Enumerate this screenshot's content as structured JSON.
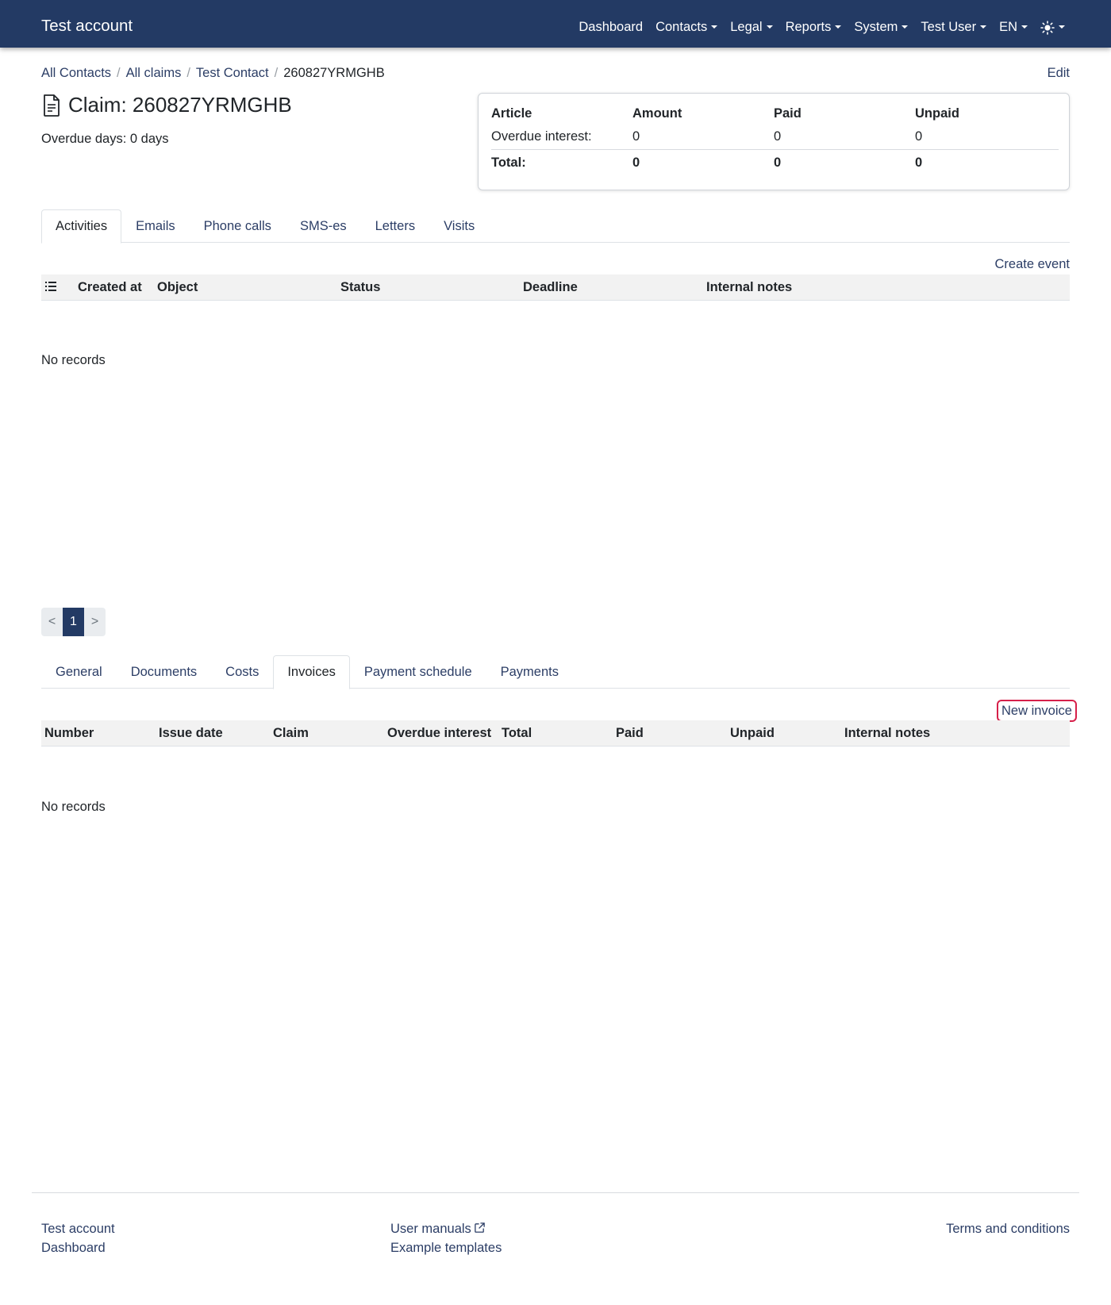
{
  "navbar": {
    "brand": "Test account",
    "items": [
      {
        "label": "Dashboard",
        "dropdown": false
      },
      {
        "label": "Contacts",
        "dropdown": true
      },
      {
        "label": "Legal",
        "dropdown": true
      },
      {
        "label": "Reports",
        "dropdown": true
      },
      {
        "label": "System",
        "dropdown": true
      },
      {
        "label": "Test User",
        "dropdown": true
      },
      {
        "label": "EN",
        "dropdown": true
      }
    ],
    "theme_icon": "sun-icon"
  },
  "breadcrumb": {
    "items": [
      "All Contacts",
      "All claims",
      "Test Contact"
    ],
    "current": "260827YRMGHB"
  },
  "edit_label": "Edit",
  "claim": {
    "title": "Claim: 260827YRMGHB",
    "overdue_days": "Overdue days: 0 days",
    "icon": "document-icon"
  },
  "summary": {
    "headers": [
      "Article",
      "Amount",
      "Paid",
      "Unpaid"
    ],
    "rows": [
      [
        "Overdue interest:",
        "0",
        "0",
        "0"
      ]
    ],
    "total": [
      "Total:",
      "0",
      "0",
      "0"
    ]
  },
  "activity_tabs": {
    "tabs": [
      "Activities",
      "Emails",
      "Phone calls",
      "SMS-es",
      "Letters",
      "Visits"
    ],
    "active": "Activities"
  },
  "activities_table": {
    "action": "Create event",
    "columns": [
      "Created at",
      "Object",
      "Status",
      "Deadline",
      "Internal notes"
    ],
    "empty_text": "No records",
    "icon": "list-icon"
  },
  "pagination": {
    "prev": "<",
    "current": "1",
    "next": ">"
  },
  "detail_tabs": {
    "tabs": [
      "General",
      "Documents",
      "Costs",
      "Invoices",
      "Payment schedule",
      "Payments"
    ],
    "active": "Invoices"
  },
  "invoices_table": {
    "action": "New invoice",
    "columns": [
      "Number",
      "Issue date",
      "Claim",
      "Overdue interest",
      "Total",
      "Paid",
      "Unpaid",
      "Internal notes"
    ],
    "empty_text": "No records"
  },
  "footer": {
    "col1": [
      "Test account",
      "Dashboard"
    ],
    "col2": [
      "User manuals",
      "Example templates"
    ],
    "col3": [
      "Terms and conditions"
    ],
    "external_icon": "external-link-icon"
  },
  "colors": {
    "navbar": "#233a64",
    "link": "#2c3e66",
    "highlight": "#d6204a"
  }
}
